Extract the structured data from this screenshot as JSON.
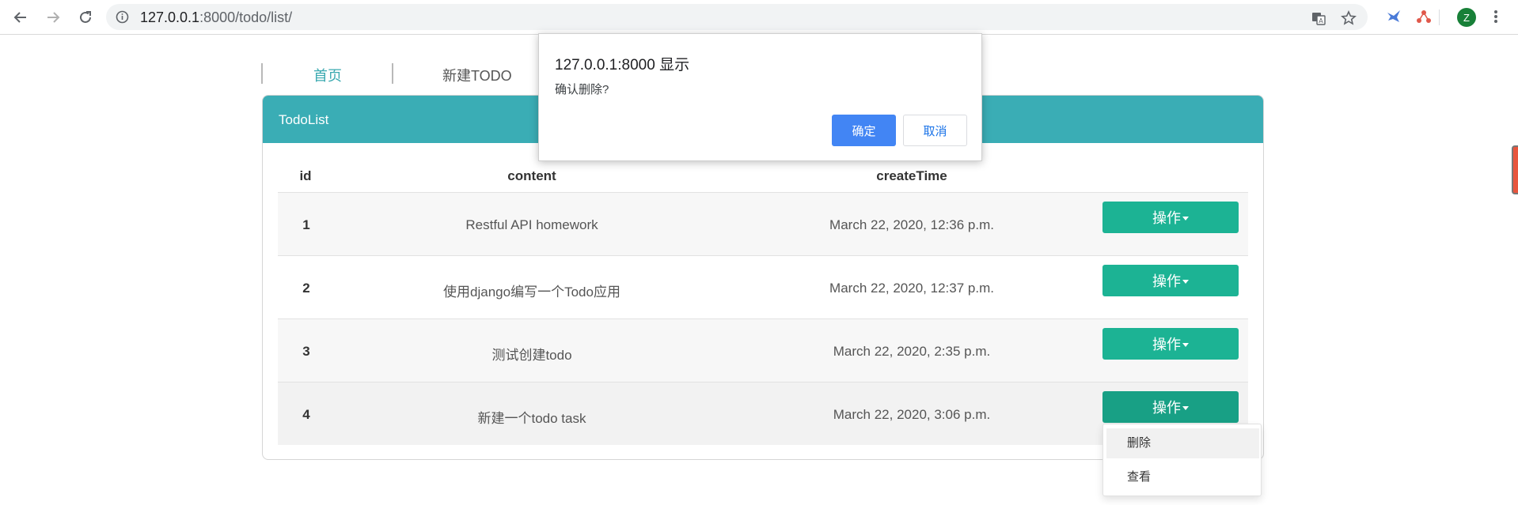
{
  "browser": {
    "url_host": "127.0.0.1",
    "url_rest": ":8000/todo/list/",
    "avatar_letter": "Z"
  },
  "nav": {
    "home": "首页",
    "new_todo": "新建TODO"
  },
  "panel": {
    "title": "TodoList"
  },
  "table": {
    "headers": {
      "id": "id",
      "content": "content",
      "create_time": "createTime"
    },
    "rows": [
      {
        "id": "1",
        "content": "Restful API homework",
        "create_time": "March 22, 2020, 12:36 p.m.",
        "action": "操作"
      },
      {
        "id": "2",
        "content": "使用django编写一个Todo应用",
        "create_time": "March 22, 2020, 12:37 p.m.",
        "action": "操作"
      },
      {
        "id": "3",
        "content": "测试创建todo",
        "create_time": "March 22, 2020, 2:35 p.m.",
        "action": "操作"
      },
      {
        "id": "4",
        "content": "新建一个todo task",
        "create_time": "March 22, 2020, 3:06 p.m.",
        "action": "操作"
      }
    ]
  },
  "dropdown": {
    "delete": "删除",
    "view": "查看"
  },
  "dialog": {
    "title": "127.0.0.1:8000 显示",
    "message": "确认删除?",
    "ok": "确定",
    "cancel": "取消"
  },
  "colors": {
    "header_teal": "#3aadb5",
    "action_green": "#1cb394",
    "dialog_blue": "#4285f4"
  }
}
